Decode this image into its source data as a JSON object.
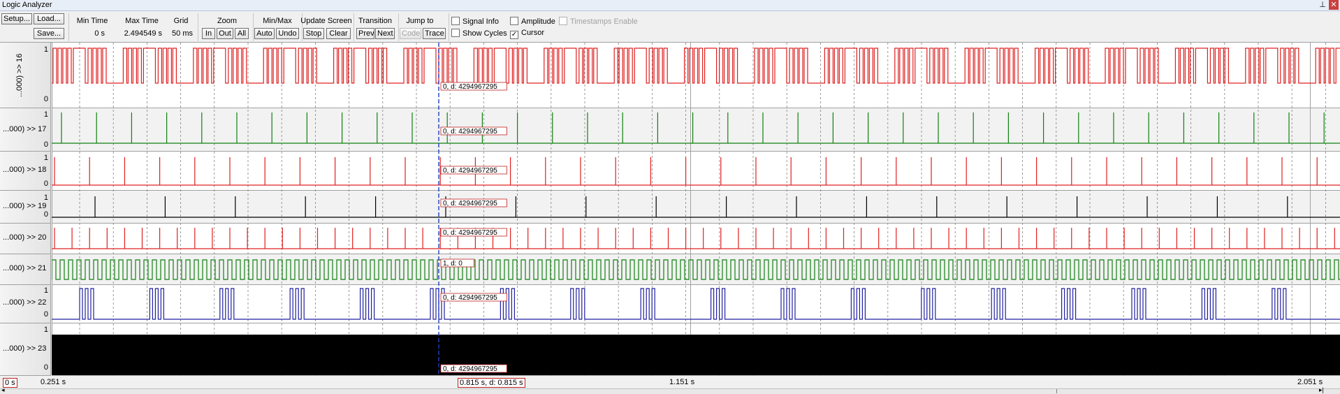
{
  "window": {
    "title": "Logic Analyzer"
  },
  "toolbar": {
    "setup_label": "Setup...",
    "load_label": "Load...",
    "save_label": "Save...",
    "min_time_label": "Min Time",
    "min_time_value": "0 s",
    "max_time_label": "Max Time",
    "max_time_value": "2.494549 s",
    "grid_label": "Grid",
    "grid_value": "50 ms",
    "zoom_label": "Zoom",
    "zoom_in": "In",
    "zoom_out": "Out",
    "zoom_all": "All",
    "minmax_label": "Min/Max",
    "minmax_auto": "Auto",
    "minmax_undo": "Undo",
    "update_screen_label": "Update Screen",
    "update_stop": "Stop",
    "update_clear": "Clear",
    "transition_label": "Transition",
    "transition_prev": "Prev",
    "transition_next": "Next",
    "jump_to_label": "Jump to",
    "jump_code": "Code",
    "jump_trace": "Trace",
    "signal_info": "Signal Info",
    "show_cycles": "Show Cycles",
    "amplitude": "Amplitude",
    "cursor": "Cursor",
    "timestamps_enable": "Timestamps Enable"
  },
  "checkboxes": {
    "signal_info": false,
    "show_cycles": false,
    "amplitude": false,
    "cursor": true,
    "timestamps_enable": false
  },
  "signals": [
    {
      "name": "...000) >> 16",
      "high": "1",
      "low": "0",
      "color": "#e02020",
      "cursor_value": "0,  d: 4294967295"
    },
    {
      "name": "...000) >> 17",
      "high": "1",
      "low": "0",
      "color": "#108010",
      "cursor_value": "0,  d: 4294967295"
    },
    {
      "name": "...000) >> 18",
      "high": "1",
      "low": "0",
      "color": "#e02020",
      "cursor_value": "0,  d: 4294967295"
    },
    {
      "name": "...000) >> 19",
      "high": "1",
      "low": "0",
      "color": "#000000",
      "cursor_value": "0,  d: 4294967295"
    },
    {
      "name": "...000) >> 20",
      "high": "",
      "low": "",
      "color": "#e02020",
      "cursor_value": "0,  d: 4294967295"
    },
    {
      "name": "...000) >> 21",
      "high": "",
      "low": "",
      "color": "#108010",
      "cursor_value": "1,  d: 0"
    },
    {
      "name": "...000) >> 22",
      "high": "1",
      "low": "0",
      "color": "#2020a0",
      "cursor_value": "0,  d: 4294967295"
    },
    {
      "name": "...000) >> 23",
      "high": "1",
      "low": "0",
      "color": "#000000",
      "cursor_value": "0,  d: 4294967295"
    }
  ],
  "status": {
    "left_time": "0 s",
    "start_time": "0.251 s",
    "cursor_time": "0.815 s,  d: 0.815 s",
    "mid_time": "1.151 s",
    "end_time": "2.051 s"
  },
  "colors": {
    "cursor_line": "#2040c0",
    "grid_line": "#808080",
    "label_border": "#c02020"
  }
}
